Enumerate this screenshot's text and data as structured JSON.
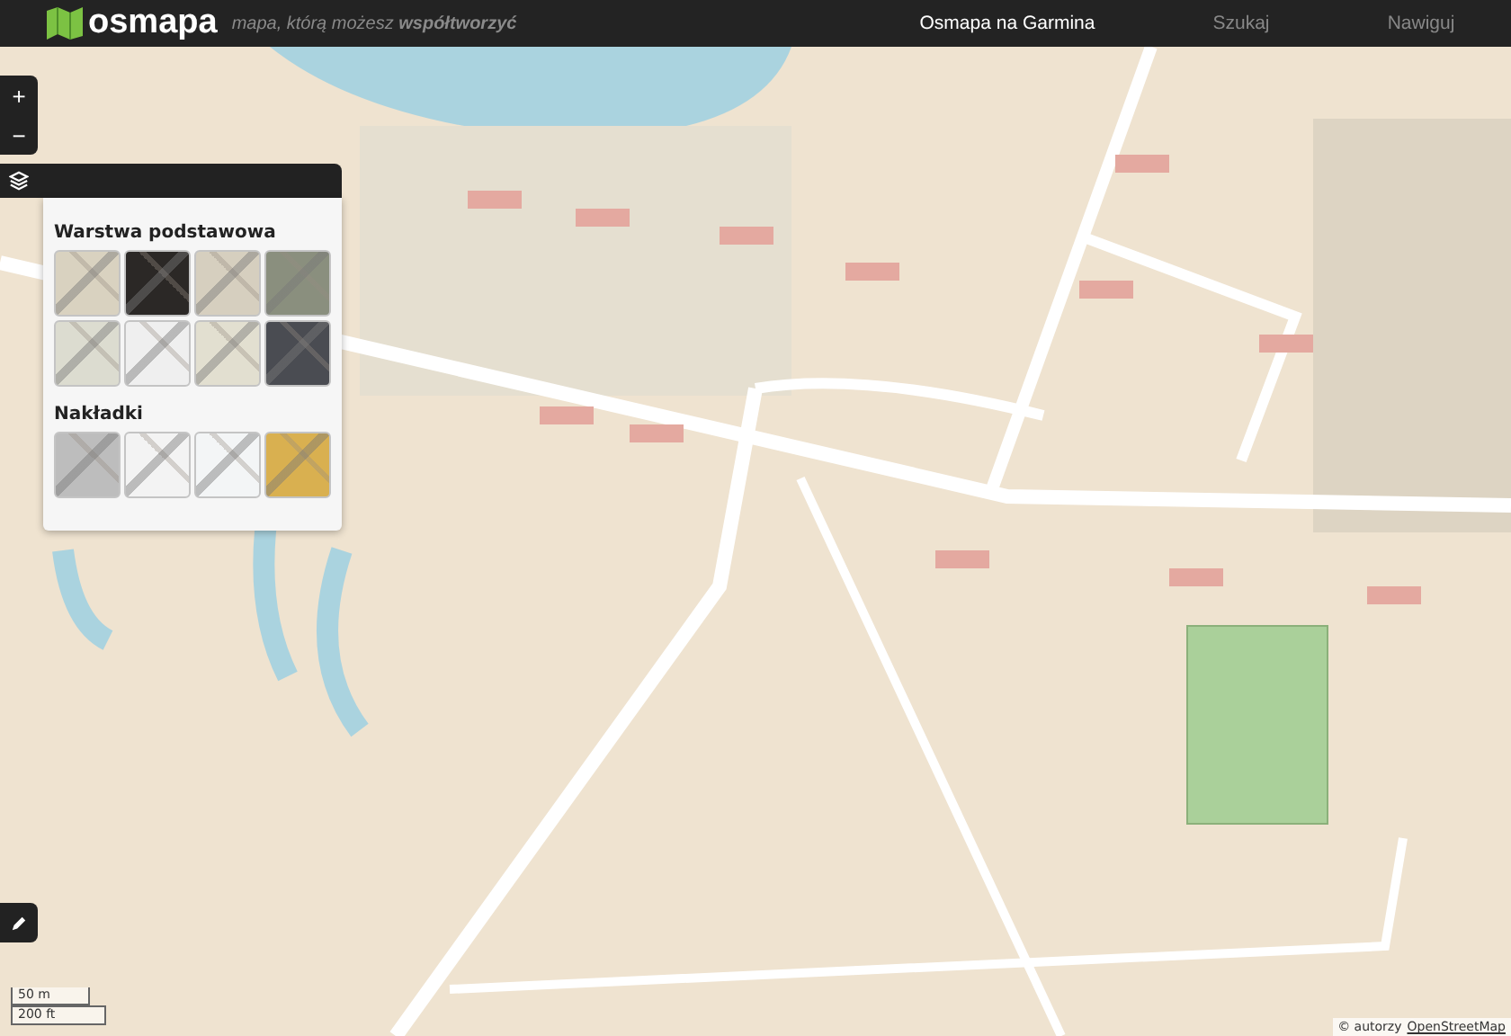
{
  "header": {
    "logo": "osmapa",
    "tagline": "mapa, którą możesz **współtworzyć**",
    "nav": [
      {
        "label": "Osmapa na Garmina",
        "selected": true
      },
      {
        "label": "Szukaj",
        "selected": false
      },
      {
        "label": "Nawiguj",
        "selected": false
      }
    ]
  },
  "zoom_controls": [
    "+",
    "−"
  ],
  "layers_panel": {
    "sections": [
      {
        "title": "Warstwa podstawowa",
        "tiles": [
          {
            "color": "#d9d2c0"
          },
          {
            "color": "#2b2826"
          },
          {
            "color": "#d6cfbf"
          },
          {
            "color": "#8a8f7e"
          },
          {
            "color": "#dcdcd0"
          },
          {
            "color": "#efefef"
          },
          {
            "color": "#e2dfd0"
          },
          {
            "color": "#4a4c52"
          }
        ]
      },
      {
        "title": "Nakładki",
        "tiles": [
          {
            "color": "#bdbdbd"
          },
          {
            "color": "#f3f3f3"
          },
          {
            "color": "#f3f5f6"
          },
          {
            "color": "#d9b050"
          }
        ]
      }
    ]
  },
  "scale": [
    "50 m",
    "200 ft"
  ],
  "attribution": {
    "prefix": "© autorzy",
    "link": "OpenStreetMap"
  }
}
